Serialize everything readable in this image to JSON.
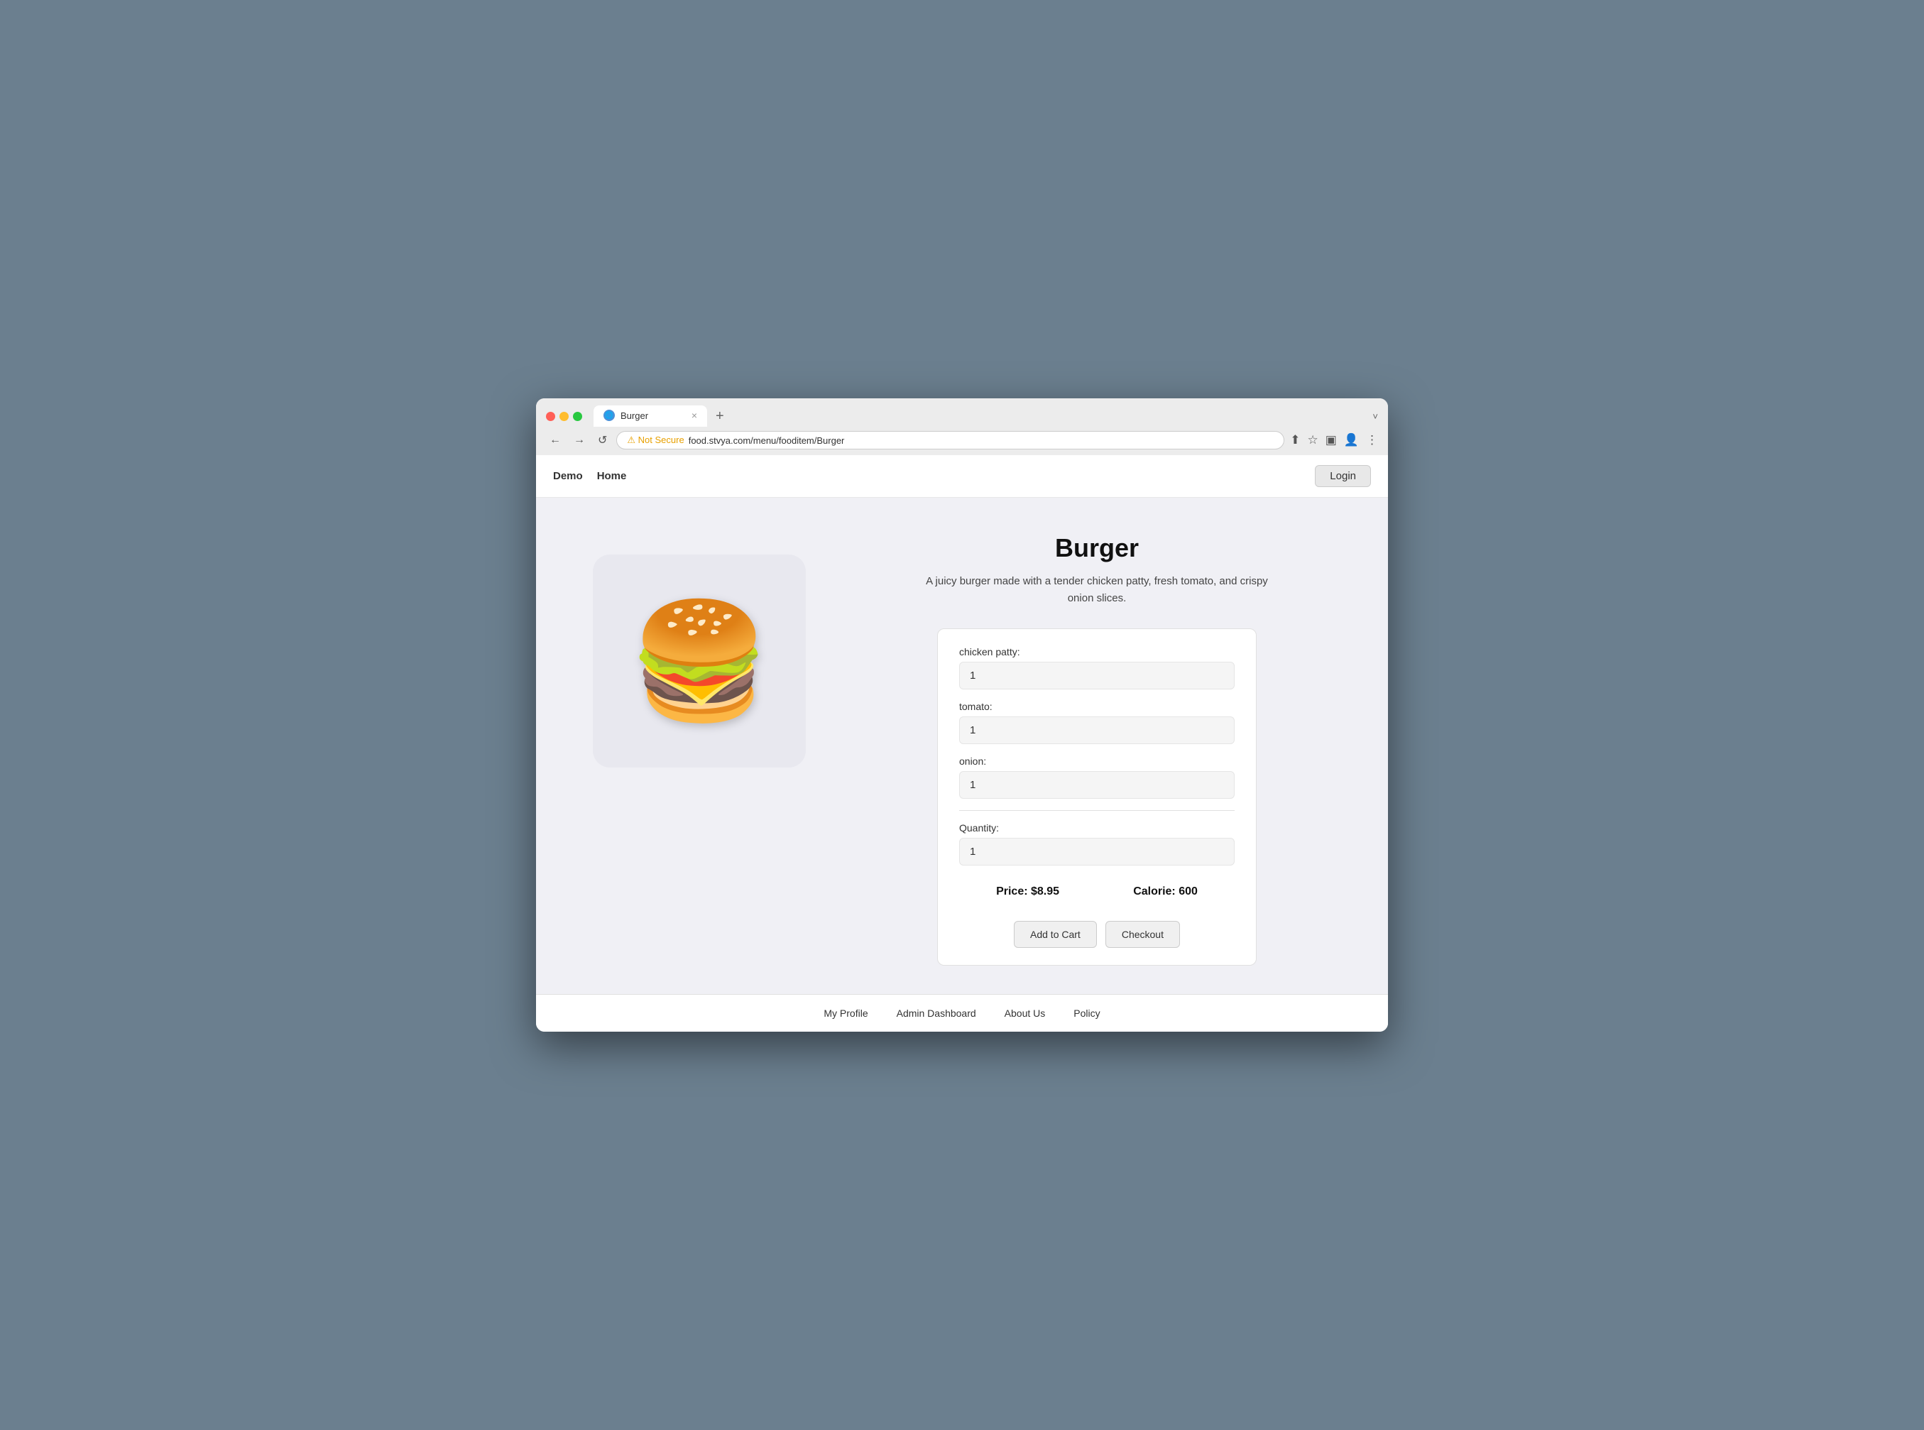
{
  "browser": {
    "tab_title": "Burger",
    "tab_close": "×",
    "tab_new": "+",
    "tab_expand": "˅",
    "nav_back": "←",
    "nav_forward": "→",
    "nav_refresh": "↺",
    "security_warning": "⚠ Not Secure",
    "url": "food.stvya.com/menu/fooditem/Burger",
    "toolbar_share": "⬆",
    "toolbar_bookmark": "☆",
    "toolbar_sidebar": "▣",
    "toolbar_profile": "👤",
    "toolbar_menu": "⋮"
  },
  "nav": {
    "demo_label": "Demo",
    "home_label": "Home",
    "login_label": "Login"
  },
  "product": {
    "title": "Burger",
    "description": "A juicy burger made with a tender chicken patty, fresh tomato, and crispy onion slices.",
    "ingredients": [
      {
        "label": "chicken patty:",
        "value": "1"
      },
      {
        "label": "tomato:",
        "value": "1"
      },
      {
        "label": "onion:",
        "value": "1"
      }
    ],
    "quantity_label": "Quantity:",
    "quantity_value": "1",
    "price_label": "Price: $8.95",
    "calorie_label": "Calorie: 600",
    "add_to_cart_label": "Add to Cart",
    "checkout_label": "Checkout"
  },
  "footer": {
    "links": [
      "My Profile",
      "Admin Dashboard",
      "About Us",
      "Policy"
    ]
  }
}
